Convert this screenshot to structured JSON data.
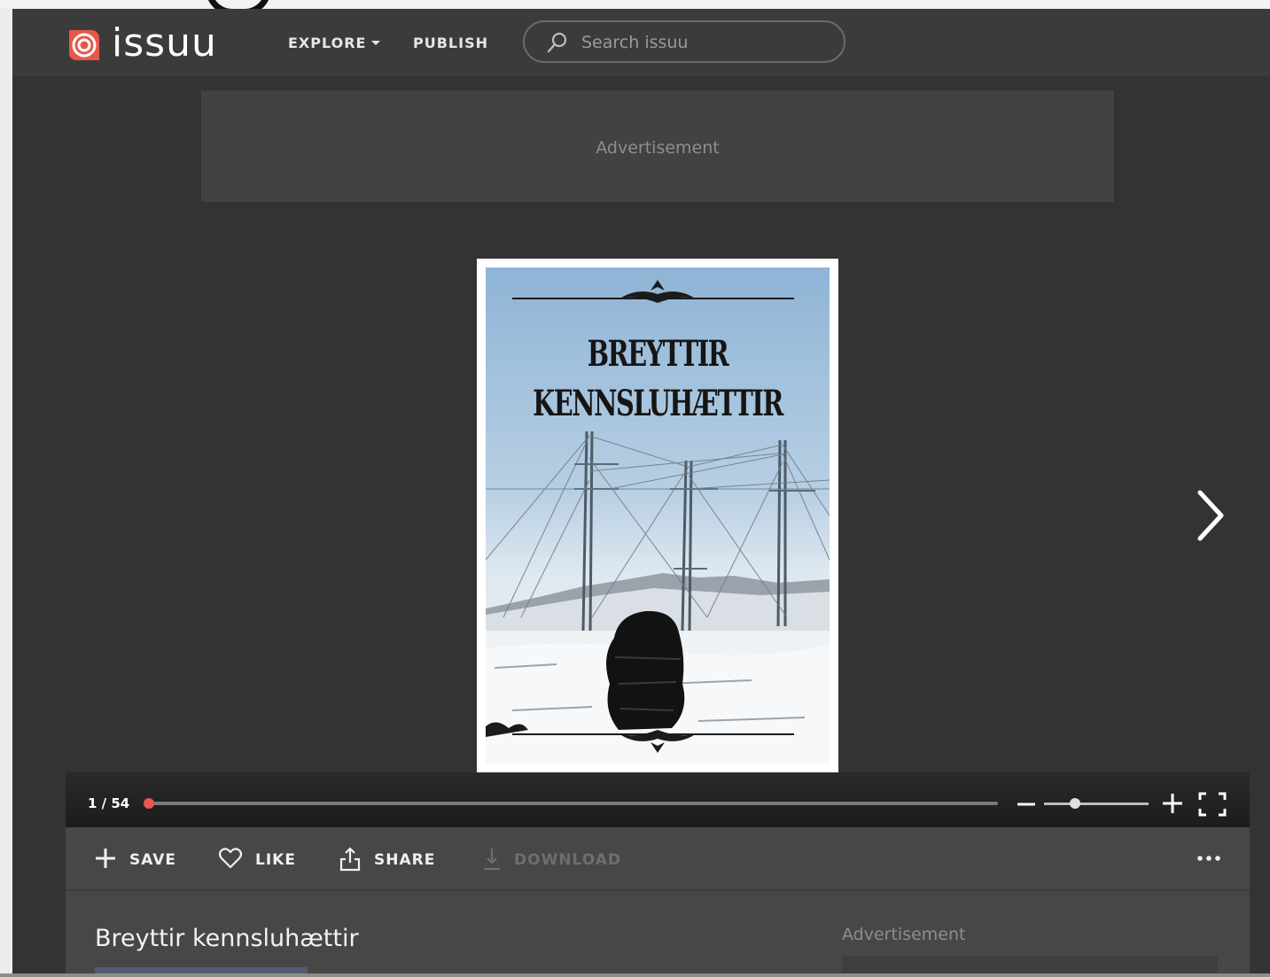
{
  "header": {
    "logo_text": "issuu",
    "nav": {
      "explore": "EXPLORE",
      "publish": "PUBLISH"
    },
    "search": {
      "placeholder": "Search issuu",
      "value": ""
    }
  },
  "ads": {
    "top_label": "Advertisement",
    "side_label": "Advertisement"
  },
  "document": {
    "cover_title_line1": "BREYTTIR",
    "cover_title_line2": "KENNSLUHÆTTIR",
    "title": "Breyttir kennsluhættir"
  },
  "viewer": {
    "page_indicator": "1 / 54",
    "current_page": 1,
    "total_pages": 54,
    "zoom_level": 0.3
  },
  "actions": {
    "save": "SAVE",
    "like": "LIKE",
    "share": "SHARE",
    "download": "DOWNLOAD"
  },
  "colors": {
    "brand": "#e8574a",
    "background": "#333333",
    "header": "#3b3b3b",
    "panel": "#474747"
  },
  "icons": [
    "issuu-logo-icon",
    "search-icon",
    "next-page-icon",
    "zoom-out-icon",
    "zoom-in-icon",
    "fullscreen-icon",
    "plus-icon",
    "heart-icon",
    "share-icon",
    "download-icon",
    "more-icon"
  ]
}
